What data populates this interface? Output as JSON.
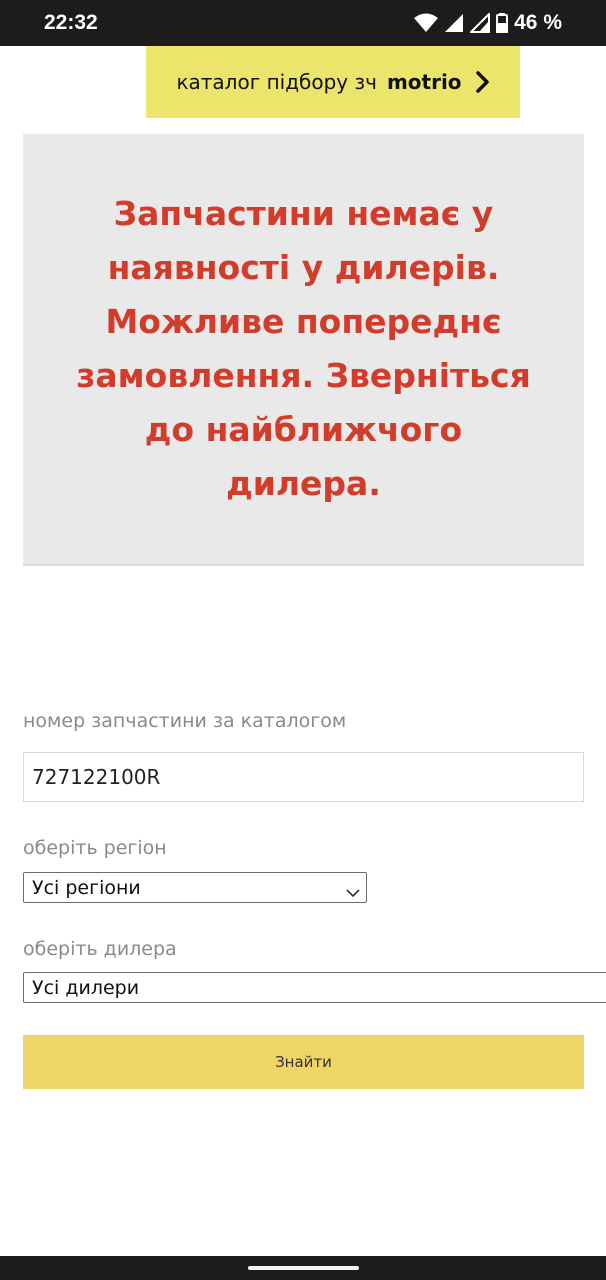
{
  "status_bar": {
    "time": "22:32",
    "battery_percent": "46 %",
    "icons": [
      "wifi-icon",
      "signal-icon",
      "signal-icon",
      "battery-icon"
    ]
  },
  "catalog_button": {
    "label": "каталог підбору зч",
    "brand": "motrio",
    "icon": "chevron-right-icon"
  },
  "notice": {
    "text": "Запчастини немає у наявності у дилерів. Можливе попереднє замовлення. Зверніться до найближчого дилера.",
    "color": "#d23c2a"
  },
  "form": {
    "part_number_label": "номер запчастини за каталогом",
    "part_number_value": "727122100R",
    "region_label": "оберіть регіон",
    "region_selected": "Усі регіони",
    "dealer_label": "оберіть дилера",
    "dealer_selected": "Усі дилери",
    "submit_label": "Знайти"
  },
  "colors": {
    "accent_yellow": "#ece56c",
    "button_yellow": "#efd566",
    "notice_bg": "#e9e9e9"
  }
}
